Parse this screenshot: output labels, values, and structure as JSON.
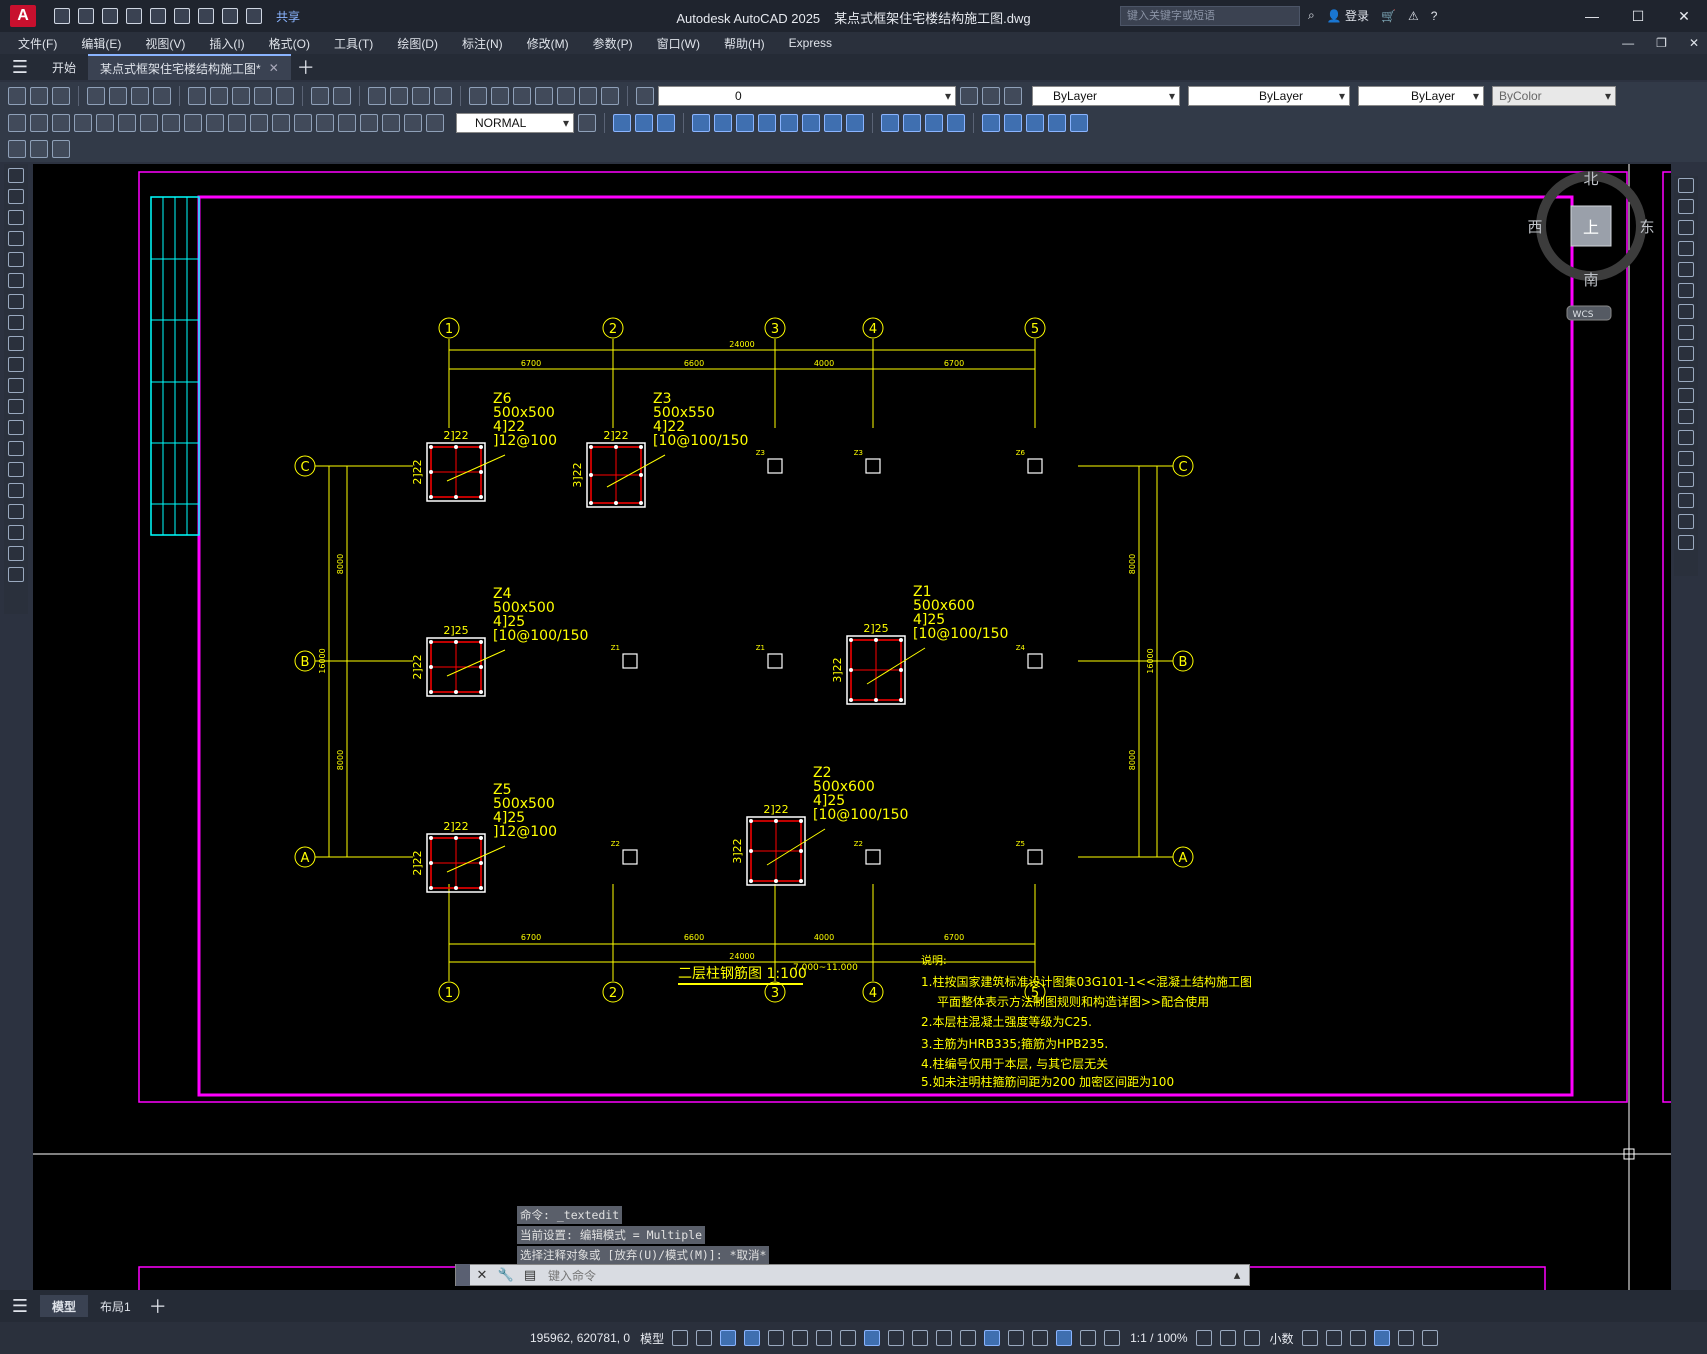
{
  "titlebar": {
    "app_letter": "A",
    "share_label": "共享",
    "app_name": "Autodesk AutoCAD 2025",
    "file_name": "某点式框架住宅楼结构施工图.dwg",
    "search_placeholder": "键入关键字或短语",
    "login_label": "登录"
  },
  "menu": [
    "文件(F)",
    "编辑(E)",
    "视图(V)",
    "插入(I)",
    "格式(O)",
    "工具(T)",
    "绘图(D)",
    "标注(N)",
    "修改(M)",
    "参数(P)",
    "窗口(W)",
    "帮助(H)",
    "Express"
  ],
  "tabs": {
    "start": "开始",
    "drawing": "某点式框架住宅楼结构施工图*"
  },
  "toolbar": {
    "layer_value": "0",
    "color_value": "ByLayer",
    "linetype_value": "ByLayer",
    "lineweight_value": "ByLayer",
    "plotstyle_value": "ByColor",
    "dimstyle_value": "NORMAL"
  },
  "viewcube": {
    "north": "北",
    "south": "南",
    "east": "东",
    "west": "西",
    "top": "上",
    "wcs": "WCS"
  },
  "drawing": {
    "axis_numbers": [
      "1",
      "2",
      "3",
      "4",
      "5"
    ],
    "axis_letters": [
      "C",
      "B",
      "A"
    ],
    "dim_total": "24000",
    "dim_spans": [
      "6700",
      "6600",
      "4000",
      "6700"
    ],
    "dim_vertical": [
      "8000",
      "16000",
      "8000"
    ],
    "columns": [
      {
        "id": "Z6",
        "size": "500x500",
        "bars": "4]22",
        "stirrup": "]12@100",
        "top": "2]22",
        "side": "2]22"
      },
      {
        "id": "Z3",
        "size": "500x550",
        "bars": "4]22",
        "stirrup": "[10@100/150",
        "top": "2]22",
        "side": "3]22"
      },
      {
        "id": "Z4",
        "size": "500x500",
        "bars": "4]25",
        "stirrup": "[10@100/150",
        "top": "2]25",
        "side": "2]22"
      },
      {
        "id": "Z1",
        "size": "500x600",
        "bars": "4]25",
        "stirrup": "[10@100/150",
        "top": "2]25",
        "side": "3]22"
      },
      {
        "id": "Z5",
        "size": "500x500",
        "bars": "4]25",
        "stirrup": "]12@100",
        "top": "2]22",
        "side": "2]22"
      },
      {
        "id": "Z2",
        "size": "500x600",
        "bars": "4]25",
        "stirrup": "[10@100/150",
        "top": "2]22",
        "side": "3]22"
      }
    ],
    "small_labels": [
      "Z3",
      "Z3",
      "Z6",
      "Z1",
      "Z1",
      "Z4",
      "Z2",
      "Z2",
      "Z5"
    ],
    "plan_title": "二层柱钢筋图 1:100",
    "plan_elev": "7.000~11.000",
    "notes_title": "说明:",
    "notes": [
      "1.柱按国家建筑标准设计图集03G101-1<<混凝土结构施工图",
      "平面整体表示方法制图规则和构造详图>>配合使用",
      "2.本层柱混凝土强度等级为C25.",
      "3.主筋为HRB335;箍筋为HPB235.",
      "4.柱编号仅用于本层, 与其它层无关",
      "5.如未注明柱箍筋间距为200 加密区间距为100"
    ]
  },
  "command": {
    "history": [
      "命令: _textedit",
      "当前设置: 编辑模式 = Multiple",
      "选择注释对象或 [放弃(U)/模式(M)]: *取消*"
    ],
    "placeholder": "键入命令"
  },
  "layouts": {
    "model": "模型",
    "layout1": "布局1"
  },
  "status": {
    "coords": "195962, 620781, 0",
    "model": "模型",
    "scale": "1:1 / 100%",
    "units": "小数"
  },
  "colors": {
    "magenta": "#ff00ff",
    "yellow": "#ffff00",
    "cyan": "#00ffff",
    "red": "#ff0000",
    "accent": "#3f6fb0"
  }
}
